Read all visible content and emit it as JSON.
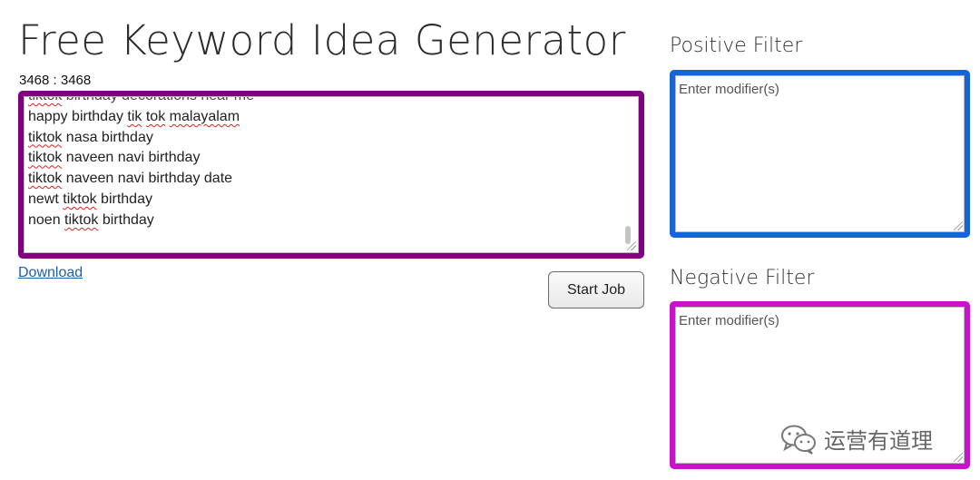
{
  "header": {
    "title": "Free Keyword Idea Generator"
  },
  "results": {
    "counter": "3468 : 3468",
    "lines": [
      [
        {
          "t": "tiktok",
          "spell": true
        },
        {
          "t": " birthday decorations near me"
        }
      ],
      [
        {
          "t": "happy birthday "
        },
        {
          "t": "tik",
          "spell": true
        },
        {
          "t": " "
        },
        {
          "t": "tok",
          "spell": true
        },
        {
          "t": " "
        },
        {
          "t": "malayalam",
          "spell": true
        }
      ],
      [
        {
          "t": "tiktok",
          "spell": true
        },
        {
          "t": " nasa birthday"
        }
      ],
      [
        {
          "t": "tiktok",
          "spell": true
        },
        {
          "t": " naveen navi birthday"
        }
      ],
      [
        {
          "t": "tiktok",
          "spell": true
        },
        {
          "t": " naveen navi birthday date"
        }
      ],
      [
        {
          "t": "newt "
        },
        {
          "t": "tiktok",
          "spell": true
        },
        {
          "t": " birthday"
        }
      ],
      [
        {
          "t": "noen "
        },
        {
          "t": "tiktok",
          "spell": true
        },
        {
          "t": " birthday"
        }
      ]
    ],
    "download_label": "Download",
    "start_label": "Start Job"
  },
  "positive_filter": {
    "label": "Positive Filter",
    "placeholder": "Enter modifier(s)",
    "value": ""
  },
  "negative_filter": {
    "label": "Negative Filter",
    "placeholder": "Enter modifier(s)",
    "value": ""
  },
  "watermark": {
    "text": "运营有道理",
    "icon": "wechat-icon"
  },
  "colors": {
    "results_border": "#800080",
    "positive_border": "#1565d8",
    "negative_border": "#cc11cc",
    "link": "#1a5fb4"
  }
}
